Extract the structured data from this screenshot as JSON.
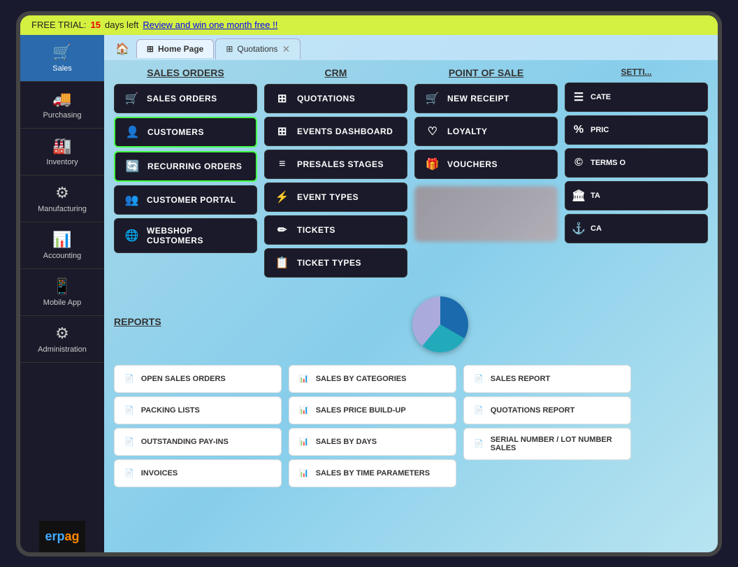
{
  "banner": {
    "prefix": "FREE TRIAL: ",
    "days": "15",
    "days_suffix": " days left",
    "link": "Review and win one month free !!"
  },
  "tabs": {
    "home_icon": "🏠",
    "items": [
      {
        "label": "Home Page",
        "active": true,
        "icon": "⊞",
        "closable": false
      },
      {
        "label": "Quotations",
        "active": false,
        "icon": "⊞",
        "closable": true
      }
    ]
  },
  "sidebar": {
    "items": [
      {
        "id": "sales",
        "label": "Sales",
        "icon": "🛒",
        "active": true
      },
      {
        "id": "purchasing",
        "label": "Purchasing",
        "icon": "🚚",
        "active": false
      },
      {
        "id": "inventory",
        "label": "Inventory",
        "icon": "🏭",
        "active": false
      },
      {
        "id": "manufacturing",
        "label": "Manufacturing",
        "icon": "⚙",
        "active": false
      },
      {
        "id": "accounting",
        "label": "Accounting",
        "icon": "📊",
        "active": false
      },
      {
        "id": "mobile",
        "label": "Mobile App",
        "icon": "📱",
        "active": false
      },
      {
        "id": "administration",
        "label": "Administration",
        "icon": "⚙",
        "active": false
      }
    ],
    "logo": "erpag"
  },
  "sections": {
    "sales_orders": {
      "header": "SALES ORDERS",
      "items": [
        {
          "icon": "🛒",
          "label": "SALES ORDERS",
          "highlight": false
        },
        {
          "icon": "👤",
          "label": "CUSTOMERS",
          "highlight": true
        },
        {
          "icon": "🔄",
          "label": "RECURRING ORDERS",
          "highlight": true
        },
        {
          "icon": "👥",
          "label": "CUSTOMER PORTAL",
          "highlight": false
        },
        {
          "icon": "🌐",
          "label": "WEBSHOP CUSTOMERS",
          "highlight": false
        }
      ]
    },
    "crm": {
      "header": "CRM",
      "items": [
        {
          "icon": "⊞",
          "label": "QUOTATIONS",
          "highlight": false
        },
        {
          "icon": "⊞",
          "label": "EVENTS DASHBOARD",
          "highlight": false
        },
        {
          "icon": "≡",
          "label": "PRESALES STAGES",
          "highlight": false
        },
        {
          "icon": "⚡",
          "label": "EVENT TYPES",
          "highlight": false
        },
        {
          "icon": "✏",
          "label": "TICKETS",
          "highlight": false
        },
        {
          "icon": "📋",
          "label": "TICKET TYPES",
          "highlight": false
        }
      ]
    },
    "pos": {
      "header": "POINT OF SALE",
      "items": [
        {
          "icon": "🛒",
          "label": "NEW RECEIPT",
          "highlight": false
        },
        {
          "icon": "♡",
          "label": "LOYALTY",
          "highlight": false
        },
        {
          "icon": "🎁",
          "label": "VOUCHERS",
          "highlight": false
        }
      ]
    },
    "settings": {
      "header": "SETTINGS",
      "items": [
        {
          "icon": "☰",
          "label": "CATE"
        },
        {
          "icon": "%",
          "label": "PRIC"
        },
        {
          "icon": "©",
          "label": "TERMS O"
        },
        {
          "icon": "🏛",
          "label": "TA"
        },
        {
          "icon": "⚓",
          "label": "CA"
        }
      ]
    }
  },
  "reports": {
    "header": "REPORTS",
    "col1": [
      {
        "label": "OPEN SALES ORDERS"
      },
      {
        "label": "PACKING LISTS"
      },
      {
        "label": "OUTSTANDING PAY-INS"
      },
      {
        "label": "INVOICES"
      }
    ],
    "col2": [
      {
        "label": "SALES BY CATEGORIES"
      },
      {
        "label": "SALES PRICE BUILD-UP"
      },
      {
        "label": "SALES BY DAYS"
      },
      {
        "label": "SALES BY TIME PARAMETERS"
      }
    ],
    "col3": [
      {
        "label": "SALES REPORT"
      },
      {
        "label": "QUOTATIONS REPORT"
      },
      {
        "label": "SERIAL NUMBER / LOT NUMBER SALES"
      }
    ]
  }
}
